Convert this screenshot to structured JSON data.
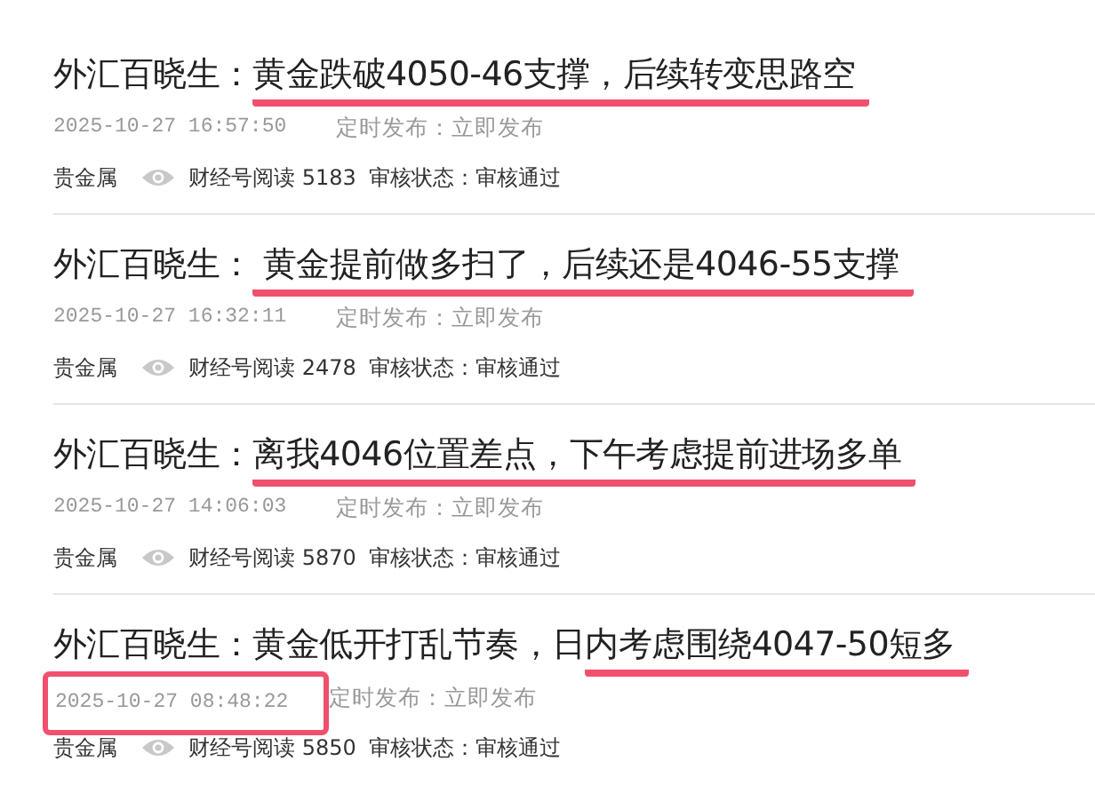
{
  "articles": [
    {
      "title_lead": "外汇百晓生：",
      "title_marked": "黄金跌破4050-46支撑，后续转变思路空",
      "date": "2025-10-27 16:57:50",
      "date_boxed": false,
      "schedule": "定时发布：立即发布",
      "category": "贵金属",
      "reads": "财经号阅读 5183",
      "review": "审核状态：审核通过"
    },
    {
      "title_lead": "外汇百晓生：",
      "title_marked": " 黄金提前做多扫了，后续还是4046-55支撑",
      "date": "2025-10-27 16:32:11",
      "date_boxed": false,
      "schedule": "定时发布：立即发布",
      "category": "贵金属",
      "reads": "财经号阅读 2478",
      "review": "审核状态：审核通过"
    },
    {
      "title_lead": "外汇百晓生：",
      "title_marked": "离我4046位置差点，下午考虑提前进场多单",
      "date": "2025-10-27 14:06:03",
      "date_boxed": false,
      "schedule": "定时发布：立即发布",
      "category": "贵金属",
      "reads": "财经号阅读 5870",
      "review": "审核状态：审核通过"
    },
    {
      "title_lead": "外汇百晓生：黄金低开打乱节奏，日",
      "title_marked": "内考虑围绕4047-50短多",
      "date": "2025-10-27 08:48:22",
      "date_boxed": true,
      "schedule": "定时发布：立即发布",
      "category": "贵金属",
      "reads": "财经号阅读 5850",
      "review": "审核状态：审核通过"
    }
  ]
}
